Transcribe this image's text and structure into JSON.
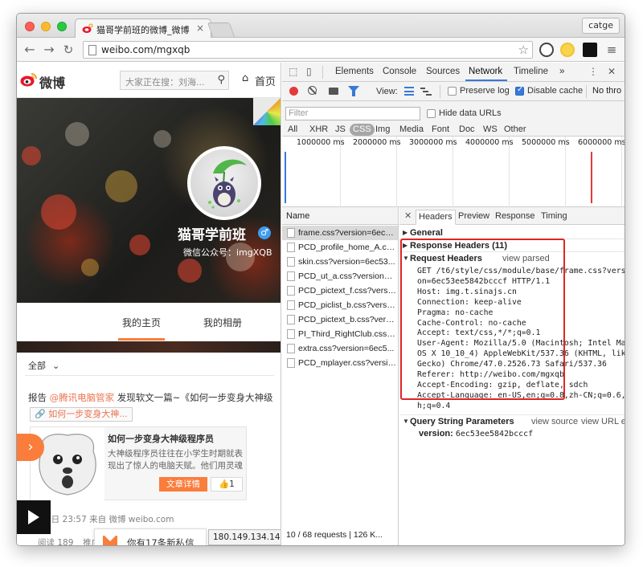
{
  "browser": {
    "tab_title": "猫哥学前班的微博_微博",
    "tab_close": "×",
    "profile_button": "catge",
    "url": "weibo.com/mgxqb"
  },
  "weibo": {
    "logo_text": "微博",
    "search_placeholder": "大家正在搜：刘海...",
    "home_label": "首页",
    "page_name": "猫哥学前班",
    "wechat_line": "微信公众号：imgXQB",
    "verified_symbol": "♂",
    "nav": {
      "my_home": "我的主页",
      "my_album": "我的相册"
    },
    "filter_label": "全部",
    "post": {
      "report_prefix": "报告 ",
      "mention": "@腾讯电脑管家",
      "report_suffix": " 发现软文一篇~《如何一步变身大神级",
      "link_pill": "🔗 如何一步变身大神...",
      "card_title": "如何一步变身大神级程序员",
      "card_desc": "大神级程序员往往在小学生时期就表现出了惊人的电脑天赋。他们用灵魂",
      "detail_button": "文章详情",
      "like_count": "👍1",
      "meta": "3日 23:57 来自 微博 weibo.com",
      "reads": "阅读 189",
      "forward": "推广"
    },
    "message_toast": "你有17条新私信",
    "ip_address": "180.149.134.142"
  },
  "devtools": {
    "tabs": [
      "Elements",
      "Console",
      "Sources",
      "Network",
      "Timeline"
    ],
    "active_tab": "Network",
    "more_tabs": "»",
    "view_label": "View:",
    "preserve_log": "Preserve log",
    "disable_cache": "Disable cache",
    "throttle": "No thro",
    "filter_placeholder": "Filter",
    "hide_data_urls": "Hide data URLs",
    "type_filters": [
      "All",
      "XHR",
      "JS",
      "CSS",
      "Img",
      "Media",
      "Font",
      "Doc",
      "WS",
      "Other"
    ],
    "active_type": "CSS",
    "timeline_ticks": [
      "1000000 ms",
      "2000000 ms",
      "3000000 ms",
      "4000000 ms",
      "5000000 ms",
      "6000000 ms"
    ],
    "name_column": "Name",
    "requests": [
      "frame.css?version=6ec5...",
      "PCD_profile_home_A.css...",
      "skin.css?version=6ec53...",
      "PCD_ut_a.css?version=6...",
      "PCD_pictext_f.css?versio...",
      "PCD_piclist_b.css?versio...",
      "PCD_pictext_b.css?versi...",
      "PI_Third_RightClub.css?i...",
      "extra.css?version=6ec5...",
      "PCD_mplayer.css?versio..."
    ],
    "status_bar": "10 / 68 requests | 126 K...",
    "detail_tabs": [
      "Headers",
      "Preview",
      "Response",
      "Timing"
    ],
    "active_detail_tab": "Headers",
    "sections": {
      "general": "General",
      "response_headers": "Response Headers (11)",
      "request_headers": "Request Headers",
      "view_parsed": "view parsed",
      "query_string": "Query String Parameters",
      "view_source": "view source",
      "view_url_encoded": "view URL e"
    },
    "request_header_lines": [
      "GET /t6/style/css/module/base/frame.css?versi",
      "on=6ec53ee5842bcccf HTTP/1.1",
      "Host: img.t.sinajs.cn",
      "Connection: keep-alive",
      "Pragma: no-cache",
      "Cache-Control: no-cache",
      "Accept: text/css,*/*;q=0.1",
      "User-Agent: Mozilla/5.0 (Macintosh; Intel Mac",
      "OS X 10_10_4) AppleWebKit/537.36 (KHTML, like",
      "Gecko) Chrome/47.0.2526.73 Safari/537.36",
      "Referer: http://weibo.com/mgxqb",
      "Accept-Encoding: gzip, deflate, sdch",
      "Accept-Language: en-US,en;q=0.8,zh-CN;q=0.6,z",
      "h;q=0.4"
    ],
    "query_param": {
      "key": "version:",
      "value": "6ec53ee5842bcccf"
    }
  },
  "colors": {
    "weibo_orange": "#fa7d3c",
    "devtools_blue": "#3879d9",
    "highlight_red": "#e02424"
  }
}
